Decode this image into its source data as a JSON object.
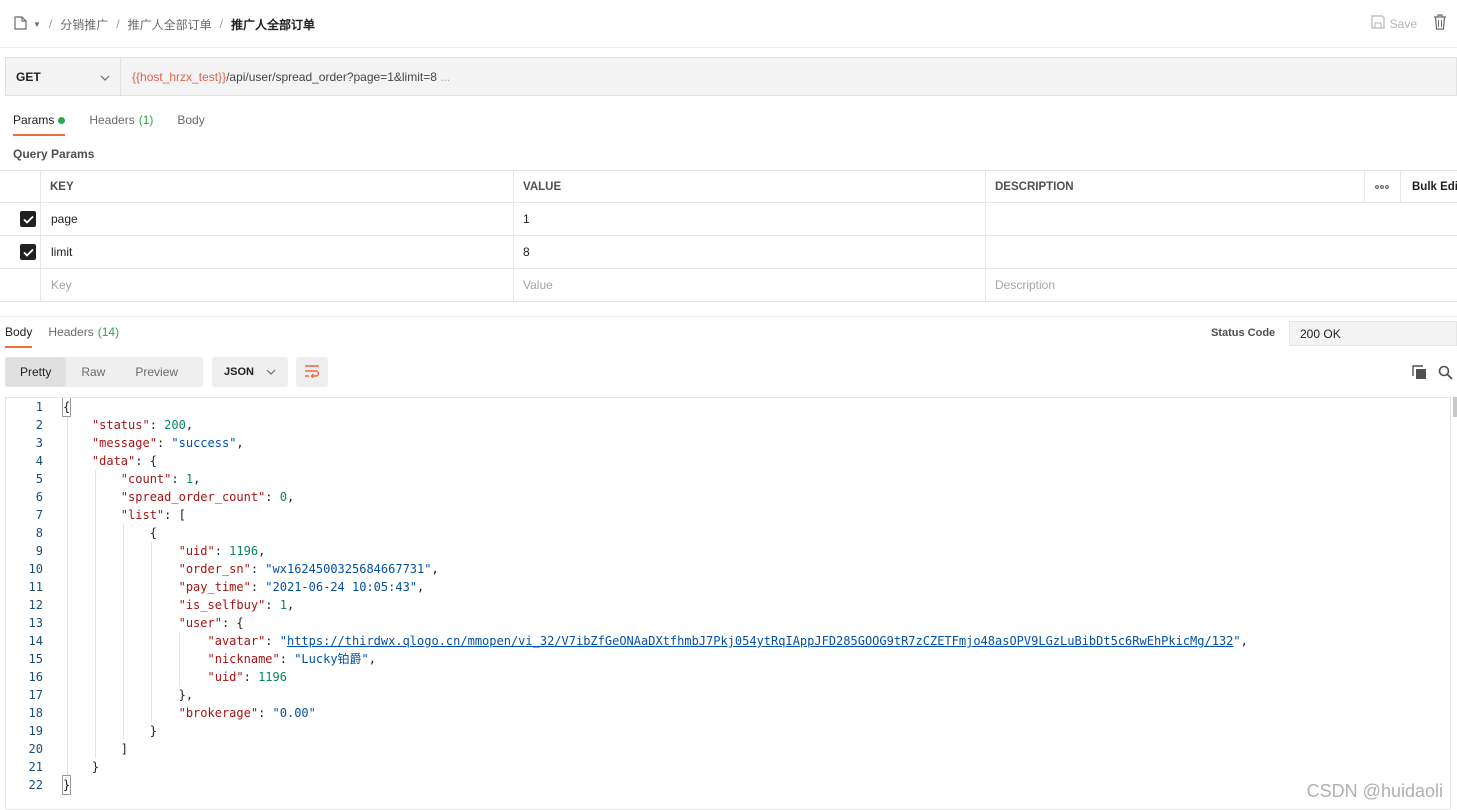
{
  "breadcrumb": {
    "items": [
      "分销推广",
      "推广人全部订单"
    ],
    "current": "推广人全部订单",
    "sep": "/"
  },
  "toolbar": {
    "save_label": "Save"
  },
  "request": {
    "method": "GET",
    "url_var": "{{host_hrzx_test}}",
    "url_path": "/api/user/spread_order?page=1&limit=8",
    "url_more": "..."
  },
  "request_tabs": [
    {
      "label": "Params",
      "count": ""
    },
    {
      "label": "Headers",
      "count": "(1)"
    },
    {
      "label": "Body",
      "count": ""
    }
  ],
  "query_params_title": "Query Params",
  "params_table": {
    "headers": {
      "key": "KEY",
      "value": "VALUE",
      "description": "DESCRIPTION",
      "bulk_edit": "Bulk Edi"
    },
    "rows": [
      {
        "checked": true,
        "key": "page",
        "value": "1",
        "description": ""
      },
      {
        "checked": true,
        "key": "limit",
        "value": "8",
        "description": ""
      }
    ],
    "placeholders": {
      "key": "Key",
      "value": "Value",
      "description": "Description"
    }
  },
  "response_tabs": [
    {
      "label": "Body",
      "count": ""
    },
    {
      "label": "Headers",
      "count": "(14)"
    }
  ],
  "status": {
    "label": "Status Code",
    "value": "200 OK"
  },
  "view_modes": [
    "Pretty",
    "Raw",
    "Preview"
  ],
  "format": "JSON",
  "code_lines": [
    "1",
    "2",
    "3",
    "4",
    "5",
    "6",
    "7",
    "8",
    "9",
    "10",
    "11",
    "12",
    "13",
    "14",
    "15",
    "16",
    "17",
    "18",
    "19",
    "20",
    "21",
    "22"
  ],
  "json": {
    "status_key": "\"status\"",
    "status_val": "200",
    "message_key": "\"message\"",
    "message_val": "\"success\"",
    "data_key": "\"data\"",
    "count_key": "\"count\"",
    "count_val": "1",
    "soc_key": "\"spread_order_count\"",
    "soc_val": "0",
    "list_key": "\"list\"",
    "uid_key": "\"uid\"",
    "uid_val": "1196",
    "order_sn_key": "\"order_sn\"",
    "order_sn_val": "\"wx1624500325684667731\"",
    "pay_time_key": "\"pay_time\"",
    "pay_time_val": "\"2021-06-24 10:05:43\"",
    "is_selfbuy_key": "\"is_selfbuy\"",
    "is_selfbuy_val": "1",
    "user_key": "\"user\"",
    "avatar_key": "\"avatar\"",
    "avatar_url": "https://thirdwx.qlogo.cn/mmopen/vi_32/V7ibZfGeONAaDXtfhmbJ7Pkj054ytRqIAppJFD285GOOG9tR7zCZETFmjo48asOPV9LGzLuBibDt5c6RwEhPkicMg/132",
    "nickname_key": "\"nickname\"",
    "nickname_val": "\"Lucky铂爵\"",
    "uid2_key": "\"uid\"",
    "uid2_val": "1196",
    "brokerage_key": "\"brokerage\"",
    "brokerage_val": "\"0.00\""
  },
  "watermark": "CSDN @huidaoli"
}
